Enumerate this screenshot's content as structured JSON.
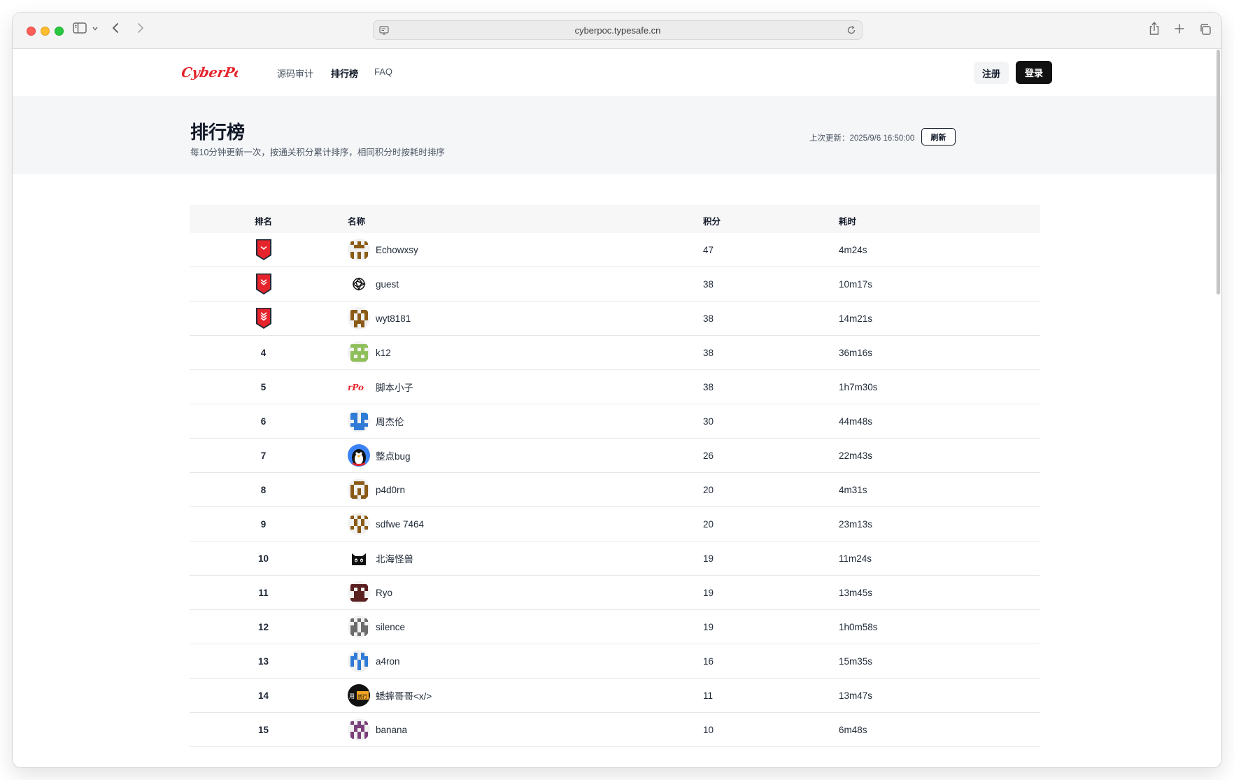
{
  "browser": {
    "url": "cyberpoc.typesafe.cn"
  },
  "nav": {
    "logo_text": "CyberPoC",
    "links": [
      "源码审计",
      "排行榜",
      "FAQ"
    ],
    "register_label": "注册",
    "login_label": "登录"
  },
  "hero": {
    "title": "排行榜",
    "subtitle": "每10分钟更新一次，按通关积分累计排序，相同积分时按耗时排序",
    "update_label": "上次更新：2025/9/6 16:50:00",
    "refresh_label": "刷新"
  },
  "table": {
    "headers": {
      "rank": "排名",
      "name": "名称",
      "score": "积分",
      "time": "耗时"
    },
    "rows": [
      {
        "rank": "",
        "medal": 1,
        "name": "Echowxsy",
        "score": "47",
        "time": "4m24s",
        "avatar": "identicon-brown"
      },
      {
        "rank": "",
        "medal": 2,
        "name": "guest",
        "score": "38",
        "time": "10m17s",
        "avatar": "openai-logo"
      },
      {
        "rank": "",
        "medal": 3,
        "name": "wyt8181",
        "score": "38",
        "time": "14m21s",
        "avatar": "identicon-brown"
      },
      {
        "rank": "4",
        "name": "k12",
        "score": "38",
        "time": "36m16s",
        "avatar": "identicon-green"
      },
      {
        "rank": "5",
        "name": "脚本小子",
        "score": "38",
        "time": "1h7m30s",
        "avatar": "cyberpoc-logo"
      },
      {
        "rank": "6",
        "name": "周杰伦",
        "score": "30",
        "time": "44m48s",
        "avatar": "identicon-blue"
      },
      {
        "rank": "7",
        "name": "整点bug",
        "score": "26",
        "time": "22m43s",
        "avatar": "penguin"
      },
      {
        "rank": "8",
        "name": "p4d0rn",
        "score": "20",
        "time": "4m31s",
        "avatar": "identicon-brown"
      },
      {
        "rank": "9",
        "name": "sdfwe 7464",
        "score": "20",
        "time": "23m13s",
        "avatar": "identicon-brown"
      },
      {
        "rank": "10",
        "name": "北海怪兽",
        "score": "19",
        "time": "11m24s",
        "avatar": "black-cat"
      },
      {
        "rank": "11",
        "name": "Ryo",
        "score": "19",
        "time": "13m45s",
        "avatar": "identicon-maroon"
      },
      {
        "rank": "12",
        "name": "silence",
        "score": "19",
        "time": "1h0m58s",
        "avatar": "identicon-gray"
      },
      {
        "rank": "13",
        "name": "a4ron",
        "score": "16",
        "time": "15m35s",
        "avatar": "identicon-blue"
      },
      {
        "rank": "14",
        "name": "蟋蟀哥哥<x/>",
        "score": "11",
        "time": "13m47s",
        "avatar": "text-badge"
      },
      {
        "rank": "15",
        "name": "banana",
        "score": "10",
        "time": "6m48s",
        "avatar": "identicon-purple"
      }
    ],
    "avatar_badge_text": "用就行"
  },
  "colors": {
    "medal_red": "#e5242c",
    "medal_dark": "#1f2937",
    "login_bg": "#111111",
    "hero_bg": "#f5f6f8"
  }
}
